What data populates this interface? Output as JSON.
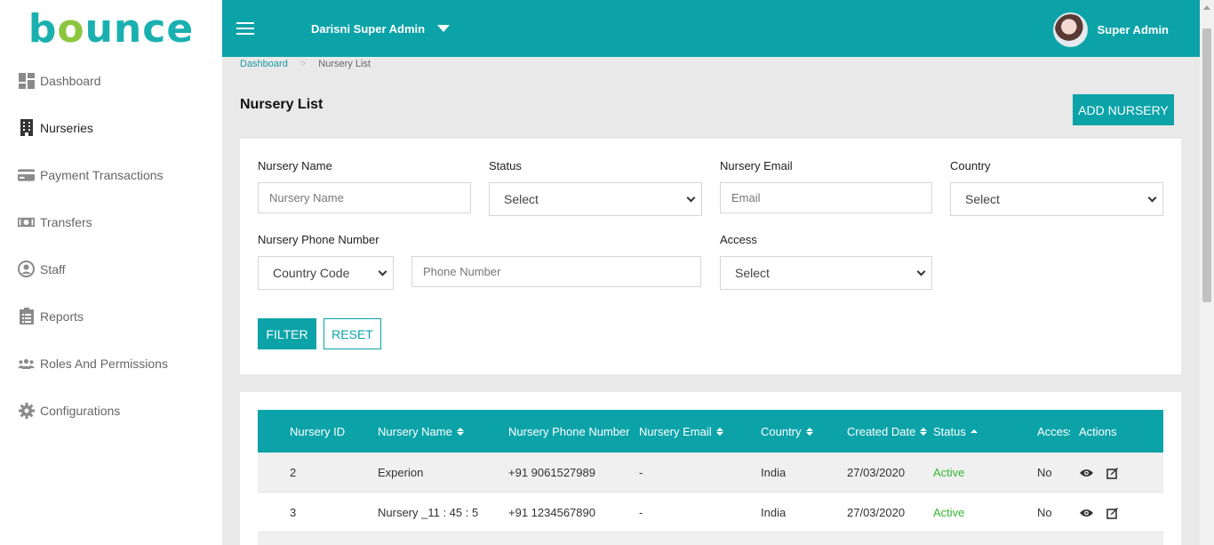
{
  "app": {
    "logo_text": "bounce",
    "brand_selector": "Darisni Super Admin",
    "user_name": "Super Admin",
    "accent": "#0ba3a8"
  },
  "sidebar": {
    "items": [
      {
        "label": "Dashboard",
        "icon": "dashboard-icon"
      },
      {
        "label": "Nurseries",
        "icon": "building-icon"
      },
      {
        "label": "Payment Transactions",
        "icon": "credit-card-icon"
      },
      {
        "label": "Transfers",
        "icon": "money-icon"
      },
      {
        "label": "Staff",
        "icon": "user-icon"
      },
      {
        "label": "Reports",
        "icon": "clipboard-icon"
      },
      {
        "label": "Roles And Permissions",
        "icon": "users-icon"
      },
      {
        "label": "Configurations",
        "icon": "gear-icon"
      }
    ],
    "active_item": "Nurseries"
  },
  "breadcrumb": {
    "home": "Dashboard",
    "current": "Nursery List"
  },
  "page": {
    "title": "Nursery List",
    "add_button": "ADD NURSERY"
  },
  "filters": {
    "nursery_name_label": "Nursery Name",
    "nursery_name_placeholder": "Nursery Name",
    "status_label": "Status",
    "status_value": "Select",
    "email_label": "Nursery Email",
    "email_placeholder": "Email",
    "country_label": "Country",
    "country_value": "Select",
    "phone_label": "Nursery Phone Number",
    "country_code_value": "Country Code",
    "phone_placeholder": "Phone Number",
    "access_label": "Access",
    "access_value": "Select",
    "filter_button": "FILTER",
    "reset_button": "RESET"
  },
  "table": {
    "columns": [
      "Nursery ID",
      "Nursery Name",
      "Nursery Phone Number",
      "Nursery Email",
      "Country",
      "Created Date",
      "Status",
      "Access",
      "Actions"
    ],
    "rows": [
      {
        "id": "2",
        "name": "Experion",
        "phone": "+91 9061527989",
        "email": "-",
        "country": "India",
        "created": "27/03/2020",
        "status": "Active",
        "access": "No"
      },
      {
        "id": "3",
        "name": "Nursery _11 : 45 : 5",
        "phone": "+91 1234567890",
        "email": "-",
        "country": "India",
        "created": "27/03/2020",
        "status": "Active",
        "access": "No"
      }
    ],
    "status_color": "#33b833"
  }
}
